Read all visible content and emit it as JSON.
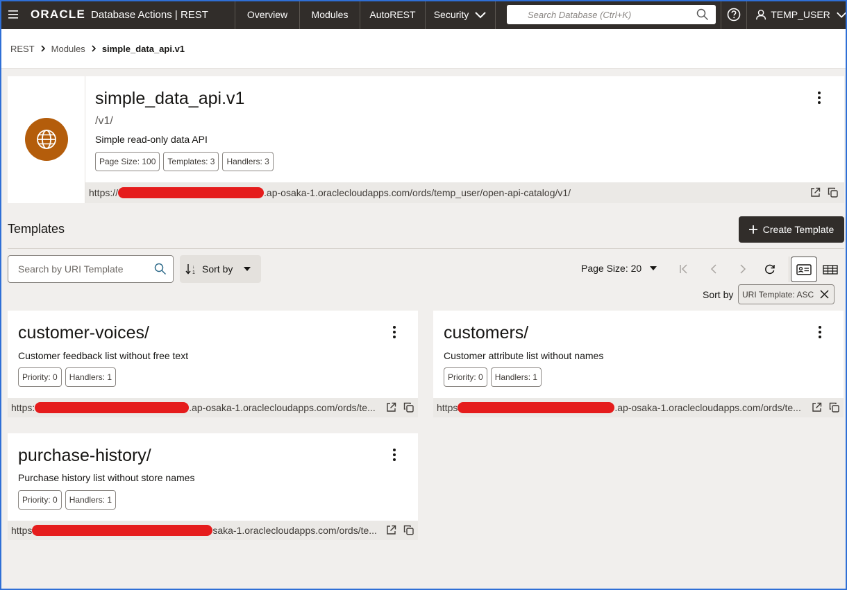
{
  "topbar": {
    "brand_logo": "ORACLE",
    "app_name": "Database Actions | REST",
    "nav": [
      "Overview",
      "Modules",
      "AutoREST",
      "Security"
    ],
    "search_placeholder": "Search Database (Ctrl+K)",
    "user": "TEMP_USER"
  },
  "breadcrumb": [
    "REST",
    "Modules",
    "simple_data_api.v1"
  ],
  "module": {
    "title": "simple_data_api.v1",
    "path": "/v1/",
    "description": "Simple read-only data API",
    "chips": [
      "Page Size: 100",
      "Templates: 3",
      "Handlers: 3"
    ],
    "url_prefix": "https://",
    "url_suffix": ".ap-osaka-1.oraclecloudapps.com/ords/temp_user/open-api-catalog/v1/"
  },
  "templates_section": {
    "title": "Templates",
    "create_label": "Create Template",
    "search_placeholder": "Search by URI Template",
    "sort_button_label": "Sort by",
    "page_size_label": "Page Size: 20",
    "sort_label": "Sort by",
    "sort_chip": "URI Template: ASC"
  },
  "templates": [
    {
      "title": "customer-voices/",
      "description": "Customer feedback list without free text",
      "chips": [
        "Priority: 0",
        "Handlers: 1"
      ],
      "url_prefix": "https:",
      "url_suffix": ".ap-osaka-1.oraclecloudapps.com/ords/te..."
    },
    {
      "title": "customers/",
      "description": "Customer attribute list without names",
      "chips": [
        "Priority: 0",
        "Handlers: 1"
      ],
      "url_prefix": "https",
      "url_suffix": ".ap-osaka-1.oraclecloudapps.com/ords/te..."
    },
    {
      "title": "purchase-history/",
      "description": "Purchase history list without store names",
      "chips": [
        "Priority: 0",
        "Handlers: 1"
      ],
      "url_prefix": "https",
      "url_suffix": "saka-1.oraclecloudapps.com/ords/te..."
    }
  ],
  "colors": {
    "topbar": "#312d2a",
    "module_icon": "#b45d0b",
    "redaction": "#e51c1c"
  }
}
